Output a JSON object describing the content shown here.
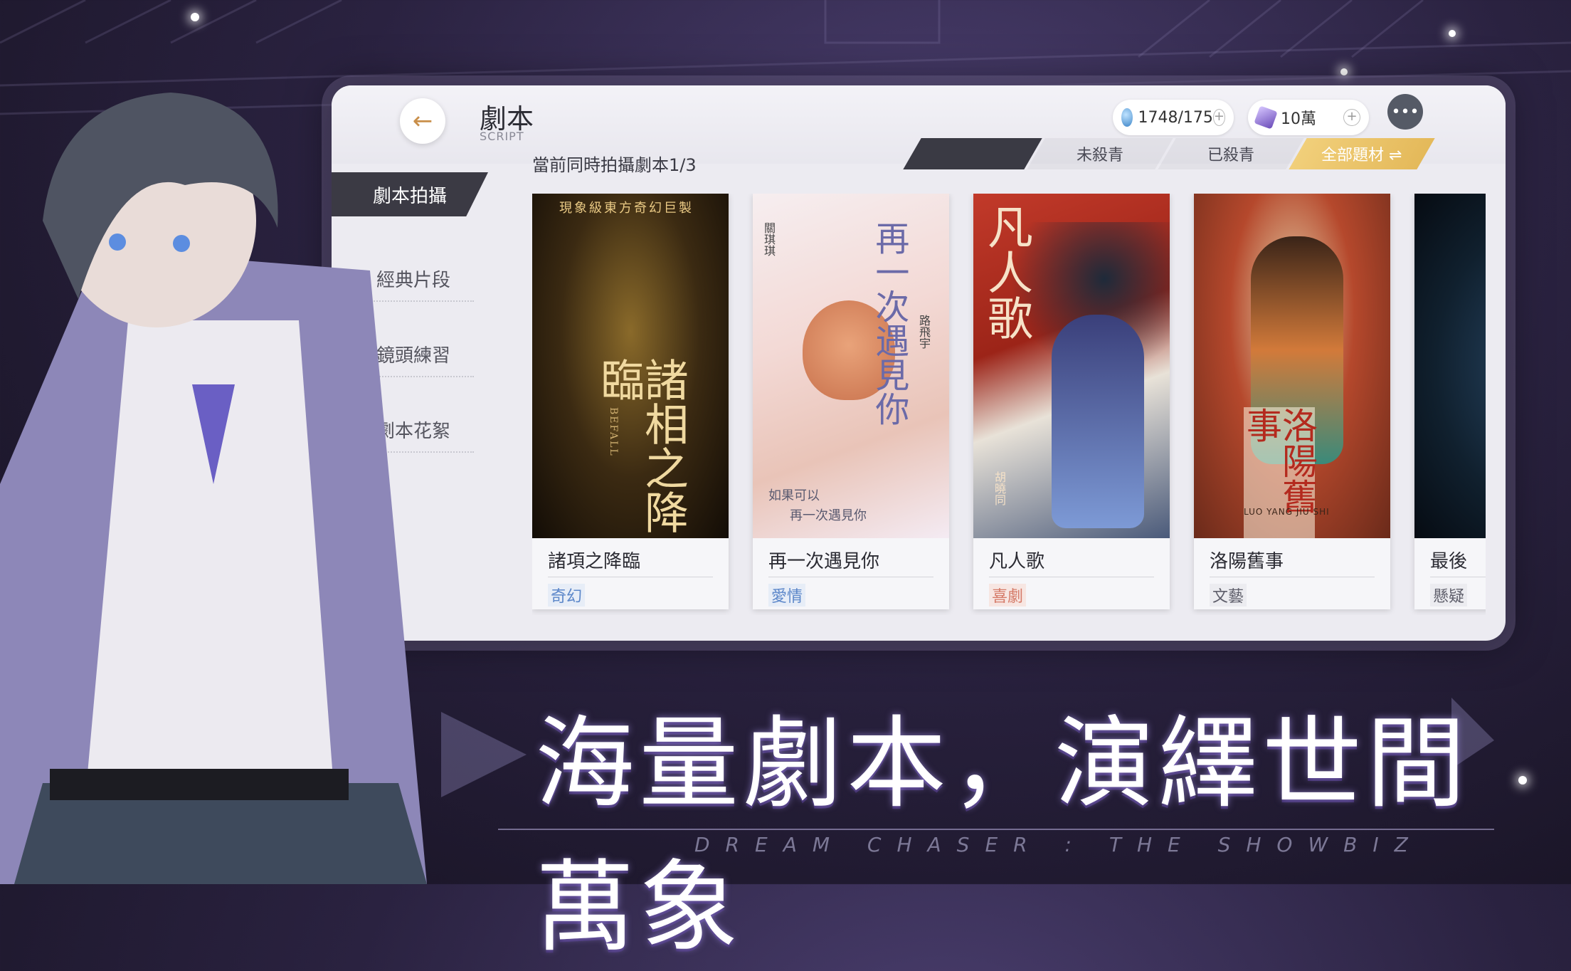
{
  "header": {
    "title": "劇本",
    "subtitle": "SCRIPT",
    "back_icon": "←"
  },
  "currencies": [
    {
      "icon": "water-drop-icon",
      "value": "1748/175"
    },
    {
      "icon": "crystal-icon",
      "value": "10萬"
    }
  ],
  "concurrent_text": "當前同時拍攝劇本1/3",
  "tabs": [
    {
      "label": ""
    },
    {
      "label": "未殺青"
    },
    {
      "label": "已殺青"
    },
    {
      "label": "全部題材 ⇌",
      "active": true
    }
  ],
  "sidebar": {
    "items": [
      {
        "label": "劇本拍攝",
        "active": true
      },
      {
        "label": "經典片段"
      },
      {
        "label": "鏡頭練習"
      },
      {
        "label": "劇本花絮"
      }
    ]
  },
  "cards": [
    {
      "name": "諸項之降臨",
      "genre": "奇幻",
      "genre_color": "#6b8fc9",
      "poster_top": "現象級東方奇幻巨製",
      "poster_title": "諸相之降臨",
      "poster_sub": "BEFALL"
    },
    {
      "name": "再一次遇見你",
      "genre": "愛情",
      "genre_color": "#6b8fc9",
      "poster_title": "再一次遇見你",
      "poster_sub1": "如果可以",
      "poster_sub2": "再一次遇見你",
      "poster_credit1": "關琪琪",
      "poster_credit2": "路飛宇"
    },
    {
      "name": "凡人歌",
      "genre": "喜劇",
      "genre_color": "#d98a7a",
      "poster_title": "凡人歌",
      "poster_credit": "胡曉同"
    },
    {
      "name": "洛陽舊事",
      "genre": "文藝",
      "genre_color": "#6c6c78",
      "poster_title": "洛陽舊事",
      "poster_sub": "LUO YANG JIU SHI"
    },
    {
      "name": "最後",
      "genre": "懸疑",
      "genre_color": "#6c6c78"
    }
  ],
  "slogan": "海量劇本，演繹世間萬象",
  "tagline": "DREAM CHASER : THE SHOWBIZ"
}
